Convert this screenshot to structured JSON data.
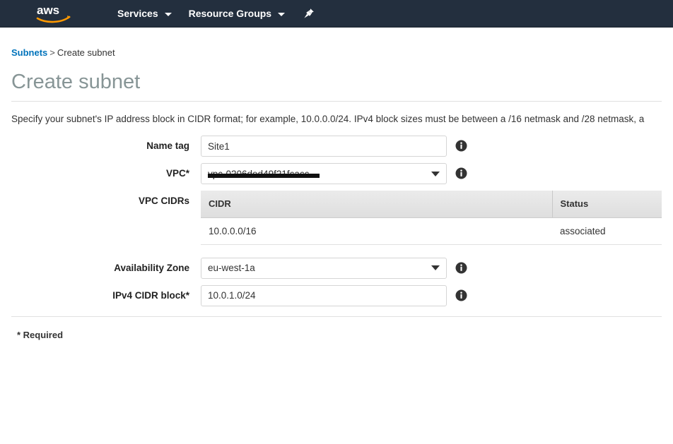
{
  "navbar": {
    "logo_alt": "aws",
    "services_label": "Services",
    "resource_groups_label": "Resource Groups",
    "pin_icon": "pin-icon",
    "background_color": "#232f3e",
    "logo_accent_color": "#ff9900"
  },
  "breadcrumb": {
    "parent_label": "Subnets",
    "separator": ">",
    "current_label": "Create subnet"
  },
  "page": {
    "title": "Create subnet",
    "description": "Specify your subnet's IP address block in CIDR format; for example, 10.0.0.0/24. IPv4 block sizes must be between a /16 netmask and /28 netmask, a",
    "required_note": "* Required"
  },
  "form": {
    "name_tag": {
      "label": "Name tag",
      "value": "Site1",
      "placeholder": "",
      "info_icon": "info-icon"
    },
    "vpc": {
      "label": "VPC*",
      "value": "vpc-0206ded49f21fcacc",
      "info_icon": "info-icon",
      "caret_icon": "chevron-down-icon"
    },
    "vpc_cidrs": {
      "label": "VPC CIDRs",
      "columns": [
        "CIDR",
        "Status"
      ],
      "rows": [
        {
          "cidr": "10.0.0.0/16",
          "status": "associated"
        }
      ],
      "status_color": "#1e8c1e"
    },
    "availability_zone": {
      "label": "Availability Zone",
      "value": "eu-west-1a",
      "info_icon": "info-icon",
      "caret_icon": "chevron-down-icon"
    },
    "ipv4_cidr_block": {
      "label": "IPv4 CIDR block*",
      "value": "10.0.1.0/24",
      "placeholder": "",
      "info_icon": "info-icon"
    }
  }
}
